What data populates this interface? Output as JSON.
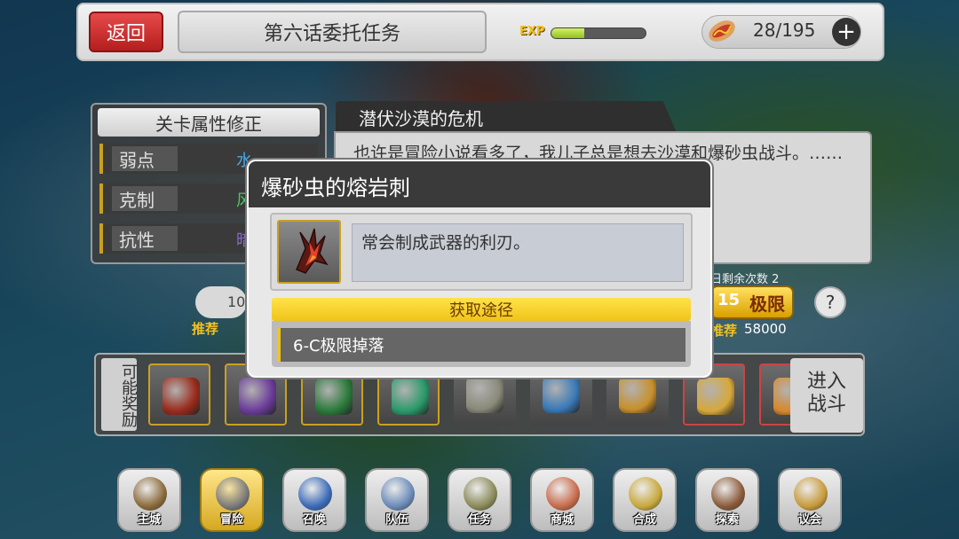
{
  "header": {
    "back_label": "返回",
    "stage_title": "第六话委托任务",
    "exp_label": "EXP",
    "exp_progress": 0.35,
    "stamina": "28/195",
    "plus_label": "+"
  },
  "attributes": {
    "title": "关卡属性修正",
    "rows": [
      {
        "label": "弱点",
        "value": "水",
        "color": "#4aa8e8"
      },
      {
        "label": "克制",
        "value": "风",
        "color": "#4ac86a"
      },
      {
        "label": "抗性",
        "value": "暗",
        "color": "#8a6ac8"
      }
    ]
  },
  "story": {
    "title": "潜伏沙漠的危机",
    "text": "也许是冒险小说看多了，我儿子总是想去沙漠和爆砂虫战斗。……亲身感受到那怪物的"
  },
  "middle": {
    "rec_left_value": "10",
    "rec_label": "推荐",
    "remain_label": "日剩余次数 2",
    "limit_count": "15",
    "limit_label": "极限",
    "rec_right_value": "58000",
    "help_label": "?"
  },
  "rewards": {
    "title": "可能奖励",
    "items": [
      {
        "name": "lava-spike",
        "border": "gold",
        "color": "#9a2a1a"
      },
      {
        "name": "purple-orb",
        "border": "gold",
        "color": "#6a3a9a"
      },
      {
        "name": "green-emblem",
        "border": "gold",
        "color": "#2a7a3a"
      },
      {
        "name": "emerald",
        "border": "gold",
        "color": "#2a9a6a"
      },
      {
        "name": "bell",
        "border": "none",
        "color": "#8a8a7a"
      },
      {
        "name": "blue-crystal",
        "border": "none",
        "color": "#3a7ab8"
      },
      {
        "name": "wood-bundle",
        "border": "none",
        "color": "#c8902a"
      },
      {
        "name": "gold-bowl",
        "border": "red",
        "color": "#d8a83a"
      },
      {
        "name": "gold-shard",
        "border": "red",
        "color": "#d8882a"
      }
    ],
    "enter_label": "进入战斗"
  },
  "nav": [
    {
      "label": "主城",
      "active": false,
      "color": "#8a6a3a"
    },
    {
      "label": "冒险",
      "active": true,
      "color": "#7a7a7a"
    },
    {
      "label": "召唤",
      "active": false,
      "color": "#3a6ab8"
    },
    {
      "label": "队伍",
      "active": false,
      "color": "#6a8ab8"
    },
    {
      "label": "任务",
      "active": false,
      "color": "#8a8a5a"
    },
    {
      "label": "商城",
      "active": false,
      "color": "#c86a4a"
    },
    {
      "label": "合成",
      "active": false,
      "color": "#c8a83a"
    },
    {
      "label": "探索",
      "active": false,
      "color": "#8a5a3a"
    },
    {
      "label": "议会",
      "active": false,
      "color": "#c89a3a"
    }
  ],
  "dialog": {
    "title": "爆砂虫的熔岩刺",
    "description": "常会制成武器的利刃。",
    "source_header": "获取途径",
    "source_item": "6-C极限掉落"
  }
}
